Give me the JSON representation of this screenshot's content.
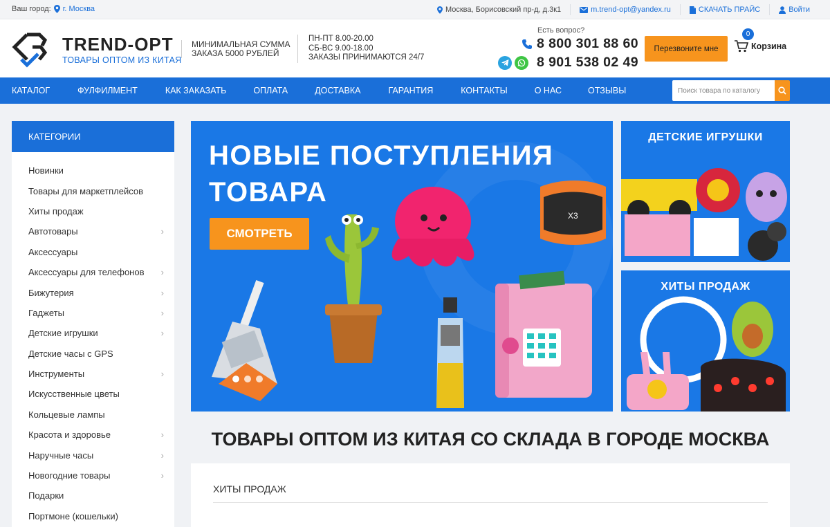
{
  "topbar": {
    "city_label": "Ваш город:",
    "city_value": "г. Москва",
    "address": "Москва, Борисовский пр-д, д.3к1",
    "email": "m.trend-opt@yandex.ru",
    "price_label": "СКАЧАТЬ ПРАЙС",
    "login_label": "Войти"
  },
  "header": {
    "brand_name": "TREND-OPT",
    "brand_tagline": "ТОВАРЫ ОПТОМ ИЗ КИТАЯ",
    "min_sum_line1": "МИНИМАЛЬНАЯ СУММА",
    "min_sum_line2": "ЗАКАЗА 5000 РУБЛЕЙ",
    "hours_line1": "ПН-ПТ 8.00-20.00",
    "hours_line2": "СБ-ВС 9.00-18.00",
    "hours_line3": "ЗАКАЗЫ ПРИНИМАЮТСЯ 24/7",
    "question": "Есть вопрос?",
    "phone1": "8 800 301 88 60",
    "phone2": "8 901 538 02 49",
    "callback_label": "Перезвоните мне",
    "cart_label": "Корзина",
    "cart_count": "0"
  },
  "nav": {
    "items": [
      "Каталог",
      "Фулфилмент",
      "Как заказать",
      "Оплата",
      "Доставка",
      "Гарантия",
      "Контакты",
      "О нас",
      "Отзывы"
    ],
    "search_placeholder": "Поиск товара по каталогу"
  },
  "sidebar": {
    "title": "Категории",
    "items": [
      {
        "label": "Новинки",
        "sub": false
      },
      {
        "label": "Товары для маркетплейсов",
        "sub": false
      },
      {
        "label": "Хиты продаж",
        "sub": false
      },
      {
        "label": "Автотовары",
        "sub": true
      },
      {
        "label": "Аксессуары",
        "sub": false
      },
      {
        "label": "Аксессуары для телефонов",
        "sub": true
      },
      {
        "label": "Бижутерия",
        "sub": true
      },
      {
        "label": "Гаджеты",
        "sub": true
      },
      {
        "label": "Детские игрушки",
        "sub": true
      },
      {
        "label": "Детские часы с GPS",
        "sub": false
      },
      {
        "label": "Инструменты",
        "sub": true
      },
      {
        "label": "Искусственные цветы",
        "sub": false
      },
      {
        "label": "Кольцевые лампы",
        "sub": false
      },
      {
        "label": "Красота и здоровье",
        "sub": true
      },
      {
        "label": "Наручные часы",
        "sub": true
      },
      {
        "label": "Новогодние товары",
        "sub": true
      },
      {
        "label": "Подарки",
        "sub": false
      },
      {
        "label": "Портмоне (кошельки)",
        "sub": false
      }
    ]
  },
  "banners": {
    "main_line1": "НОВЫЕ ПОСТУПЛЕНИЯ",
    "main_line2": "ТОВАРА",
    "main_cta": "СМОТРЕТЬ",
    "side1_title": "ДЕТСКИЕ ИГРУШКИ",
    "side2_title": "ХИТЫ ПРОДАЖ"
  },
  "content": {
    "heading": "ТОВАРЫ ОПТОМ ИЗ КИТАЯ СО СКЛАДА В ГОРОДЕ МОСКВА",
    "hits_title": "Хиты продаж"
  },
  "colors": {
    "brand_blue": "#1a6fd9",
    "accent_orange": "#f7941d"
  }
}
